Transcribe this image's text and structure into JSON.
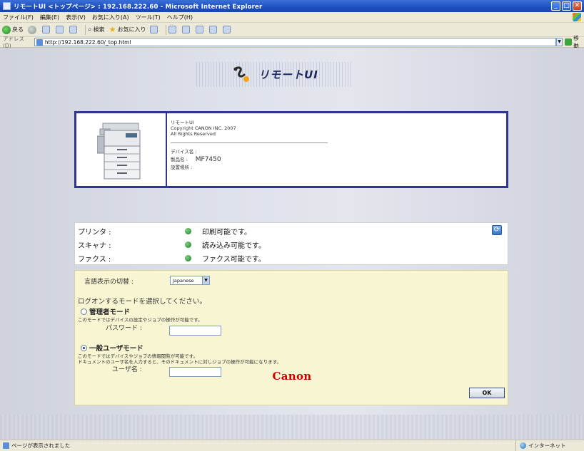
{
  "window": {
    "title": "リモートUI <トップページ> : 192.168.222.60 - Microsoft Internet Explorer",
    "minimize": "_",
    "maximize": "□",
    "close": "✕"
  },
  "menu": [
    "ファイル(F)",
    "編集(E)",
    "表示(V)",
    "お気に入り(A)",
    "ツール(T)",
    "ヘルプ(H)"
  ],
  "toolbar": {
    "back": "戻る",
    "search": "検索",
    "favorites": "お気に入り"
  },
  "address": {
    "label": "アドレス(D)",
    "url": "http://192.168.222.60/_top.html",
    "go": "移動"
  },
  "banner": {
    "title": "リモートUI"
  },
  "device_info": {
    "product_line": "リモートUI",
    "copyright": "Copyright CANON INC. 2007",
    "rights": "All Rights Reserved",
    "device_name_label": "デバイス名 :",
    "product_name_label": "製品名 :",
    "product_name": "MF7450",
    "location_label": "設置場所 :"
  },
  "status": {
    "printer_label": "プリンタ :",
    "printer_msg": "印刷可能です。",
    "scanner_label": "スキャナ :",
    "scanner_msg": "読み込み可能です。",
    "fax_label": "ファクス :",
    "fax_msg": "ファクス可能です。",
    "status_color": "#2c8a3a"
  },
  "login": {
    "language_label": "言語表示の切替 :",
    "language_value": "Japanese",
    "prompt": "ログオンするモードを選択してください。",
    "admin_mode": "管理者モード",
    "admin_desc": "このモードではデバイスの設定やジョブの操作が可能です。",
    "password_label": "パスワード :",
    "user_mode": "一般ユーザモード",
    "user_desc_1": "このモードではデバイスやジョブの情報閲覧が可能です。",
    "user_desc_2": "ドキュメントのユーザ名を入力すると、そのドキュメントに対しジョブの操作が可能になります。",
    "username_label": "ユーザ名 :",
    "selected_mode": "user",
    "ok": "OK"
  },
  "footer": {
    "brand": "Canon",
    "brand_color": "#cc0000"
  },
  "statusbar": {
    "message": "ページが表示されました",
    "zone": "インターネット"
  }
}
